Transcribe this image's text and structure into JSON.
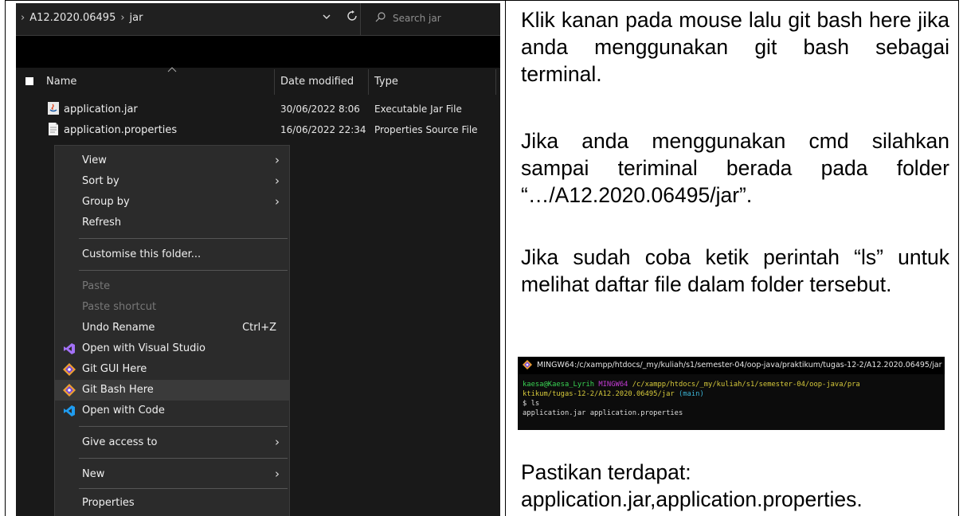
{
  "explorer": {
    "address": {
      "seg1": "A12.2020.06495",
      "seg2": "jar",
      "lead_chevron": "›",
      "sep": "›"
    },
    "search_placeholder": "Search jar",
    "columns": {
      "name": "Name",
      "date": "Date modified",
      "type": "Type"
    },
    "files": [
      {
        "name": "application.jar",
        "date": "30/06/2022 8:06",
        "type": "Executable Jar File"
      },
      {
        "name": "application.properties",
        "date": "16/06/2022 22:34",
        "type": "Properties Source File"
      }
    ],
    "menu": {
      "view": "View",
      "sort_by": "Sort by",
      "group_by": "Group by",
      "refresh": "Refresh",
      "customise": "Customise this folder...",
      "paste": "Paste",
      "paste_shortcut": "Paste shortcut",
      "undo_rename": "Undo Rename",
      "undo_shortcut": "Ctrl+Z",
      "open_vs": "Open with Visual Studio",
      "git_gui": "Git GUI Here",
      "git_bash": "Git Bash Here",
      "open_code": "Open with Code",
      "give_access": "Give access to",
      "new": "New",
      "properties": "Properties",
      "arrow": "›"
    }
  },
  "instructions": {
    "p1": "Klik kanan pada mouse lalu git bash here jika anda menggunakan git bash sebagai terminal.",
    "p2": "Jika anda menggunakan cmd silahkan sampai teriminal berada pada folder “…/A12.2020.06495/jar”.",
    "p3": "Jika sudah coba ketik perintah “ls” untuk melihat daftar file dalam folder tersebut.",
    "p4_line1": "Pastikan terdapat:",
    "p4_line2": "application.jar,application.properties."
  },
  "terminal": {
    "title": "MINGW64:/c/xampp/htdocs/_my/kuliah/s1/semester-04/oop-java/praktikum/tugas-12-2/A12.2020.06495/jar",
    "user": "kaesa@Kaesa_Lyrih",
    "env": "MINGW64",
    "path1": "/c/xampp/htdocs/_my/kuliah/s1/semester-04/oop-java/pra",
    "path2": "ktikum/tugas-12-2/A12.2020.06495/jar",
    "branch": "(main)",
    "command": "$ ls",
    "output": "application.jar  application.properties",
    "colors": {
      "user": "#39d353",
      "env": "#c43bd6",
      "path": "#d6c93b",
      "branch": "#3bb5d6"
    }
  }
}
